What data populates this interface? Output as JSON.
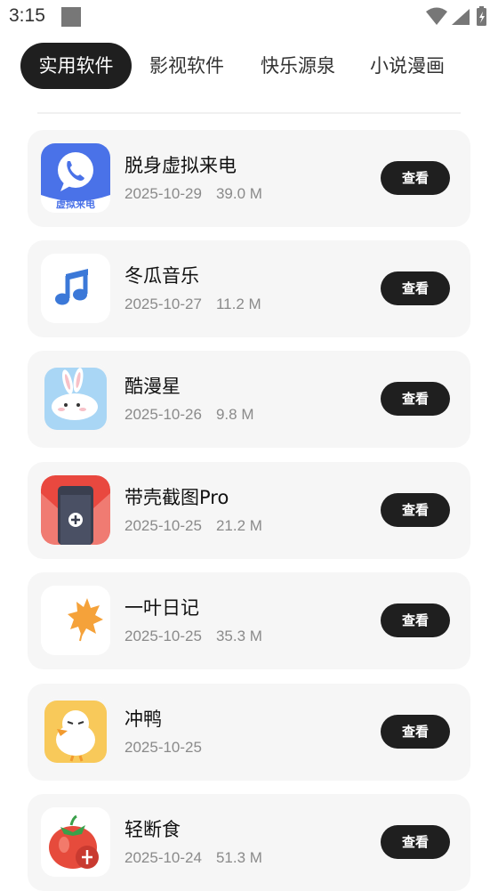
{
  "status_bar": {
    "time": "3:15"
  },
  "tabs": [
    {
      "label": "实用软件",
      "active": true
    },
    {
      "label": "影视软件",
      "active": false
    },
    {
      "label": "快乐源泉",
      "active": false
    },
    {
      "label": "小说漫画",
      "active": false
    }
  ],
  "apps": [
    {
      "name": "脱身虚拟来电",
      "date": "2025-10-29",
      "size": "39.0 M",
      "button": "查看",
      "icon": "phone-call-icon",
      "icon_text": "虚拟来电"
    },
    {
      "name": "冬瓜音乐",
      "date": "2025-10-27",
      "size": "11.2 M",
      "button": "查看",
      "icon": "music-note-icon"
    },
    {
      "name": "酷漫星",
      "date": "2025-10-26",
      "size": "9.8 M",
      "button": "查看",
      "icon": "rabbit-icon"
    },
    {
      "name": "带壳截图Pro",
      "date": "2025-10-25",
      "size": "21.2 M",
      "button": "查看",
      "icon": "phone-screenshot-icon"
    },
    {
      "name": "一叶日记",
      "date": "2025-10-25",
      "size": "35.3 M",
      "button": "查看",
      "icon": "maple-leaf-icon"
    },
    {
      "name": "冲鸭",
      "date": "2025-10-25",
      "size": "",
      "button": "查看",
      "icon": "duck-icon"
    },
    {
      "name": "轻断食",
      "date": "2025-10-24",
      "size": "51.3 M",
      "button": "查看",
      "icon": "tomato-icon"
    }
  ],
  "colors": {
    "active_tab_bg": "#1f1f1f",
    "card_bg": "#f6f6f6",
    "button_bg": "#1f1f1f"
  }
}
